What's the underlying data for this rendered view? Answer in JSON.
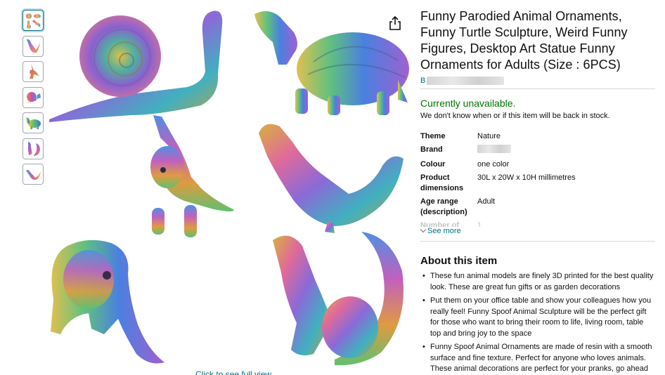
{
  "thumbnails": [
    {
      "name": "thumbnail-all-figures"
    },
    {
      "name": "thumbnail-bird"
    },
    {
      "name": "thumbnail-unicorn"
    },
    {
      "name": "thumbnail-snail"
    },
    {
      "name": "thumbnail-turtle"
    },
    {
      "name": "thumbnail-squirrel"
    },
    {
      "name": "thumbnail-bird-side"
    }
  ],
  "image": {
    "full_view_link": "Click to see full view",
    "share_icon": "share-icon"
  },
  "product": {
    "title": "Funny Parodied Animal Ornaments, Funny Turtle Sculpture, Weird Funny Figures, Desktop Art Statue Funny Ornaments for Adults (Size : 6PCS)",
    "brand_link_prefix": "B",
    "availability": "Currently unavailable.",
    "stock_note": "We don't know when or if this item will be back in stock."
  },
  "specs": [
    {
      "key": "Theme",
      "value": "Nature"
    },
    {
      "key": "Brand",
      "value": ""
    },
    {
      "key": "Colour",
      "value": "one color"
    },
    {
      "key": "Product dimensions",
      "value": "30L x 20W x 10H millimetres"
    },
    {
      "key": "Age range (description)",
      "value": "Adult"
    },
    {
      "key": "Number of",
      "value": "1"
    }
  ],
  "see_more": "See more",
  "about": {
    "title": "About this item",
    "bullets": [
      "These fun animal models are finely 3D printed for the best quality look. These are great fun gifts or as garden decorations",
      "Put them on your office table and show your colleagues how you really feel! Funny Spoof Animal Sculpture will be the perfect gift for those who want to bring their room to life, living room, table top and bring joy to the space",
      "Funny Spoof Animal Ornaments are made of resin with a smooth surface and fine texture. Perfect for anyone who loves animals. These animal decorations are perfect for your pranks, go ahead and make your family and friends laugh"
    ]
  },
  "colors": {
    "link": "#007185",
    "available": "#007600",
    "text": "#0f1111",
    "divider": "#d5d9d9"
  }
}
